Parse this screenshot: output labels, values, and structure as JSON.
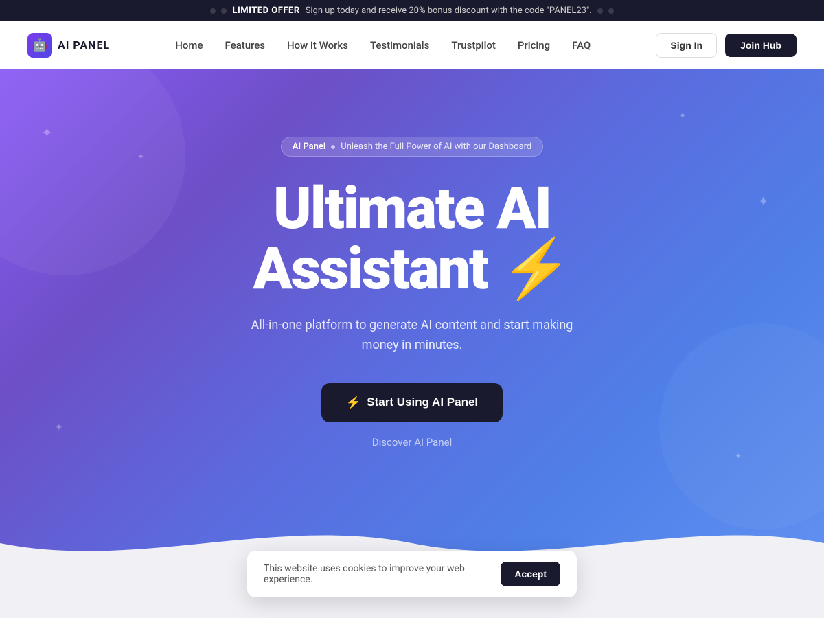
{
  "announcement": {
    "offer_label": "LIMITED OFFER",
    "offer_text": "Sign up today and receive 20% bonus discount with the code \"PANEL23\"."
  },
  "nav": {
    "logo_text": "AI PANEL",
    "logo_icon": "🤖",
    "links": [
      {
        "label": "Home",
        "id": "home"
      },
      {
        "label": "Features",
        "id": "features"
      },
      {
        "label": "How it Works",
        "id": "how-it-works"
      },
      {
        "label": "Testimonials",
        "id": "testimonials"
      },
      {
        "label": "Trustpilot",
        "id": "trustpilot"
      },
      {
        "label": "Pricing",
        "id": "pricing"
      },
      {
        "label": "FAQ",
        "id": "faq"
      }
    ],
    "signin_label": "Sign In",
    "join_label": "Join Hub"
  },
  "hero": {
    "badge_brand": "AI Panel",
    "badge_text": "Unleash the Full Power of AI with our Dashboard",
    "title_line1": "Ultimate AI",
    "title_line2": "Assistant ⚡",
    "subtitle": "All-in-one platform to generate AI content and start making money in minutes.",
    "cta_label": "⚡ Start Using AI Panel",
    "discover_label": "Discover AI Panel"
  },
  "cookie": {
    "message": "This website uses cookies to improve your web experience.",
    "accept_label": "Accept"
  }
}
